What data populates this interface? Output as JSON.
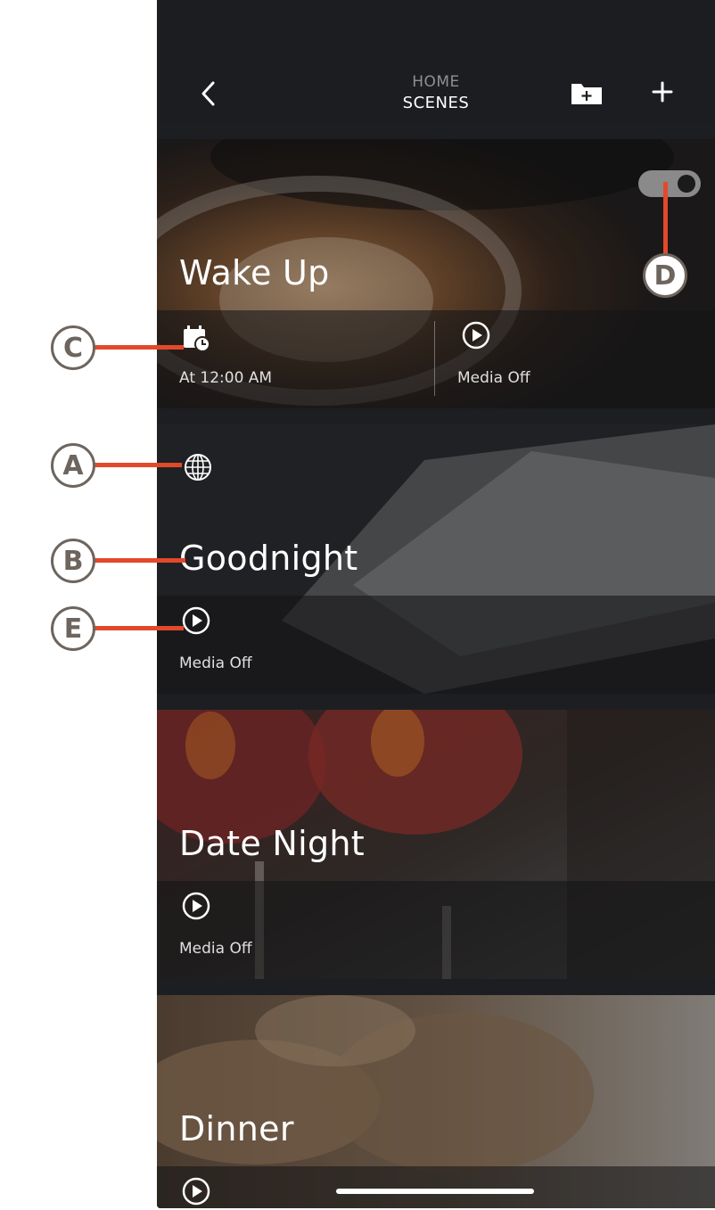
{
  "header": {
    "back_icon": "chevron-left-icon",
    "title_top": "HOME",
    "title_main": "SCENES",
    "folder_icon": "folder-add-icon",
    "add_icon": "plus-icon"
  },
  "scenes": [
    {
      "title": "Wake Up",
      "toggle_on": false,
      "actions": [
        {
          "icon": "calendar-clock-icon",
          "label": "At 12:00 AM"
        },
        {
          "icon": "play-circle-icon",
          "label": "Media Off"
        }
      ]
    },
    {
      "title": "Goodnight",
      "badge_icon": "globe-icon",
      "actions": [
        {
          "icon": "play-circle-icon",
          "label": "Media Off"
        }
      ]
    },
    {
      "title": "Date Night",
      "actions": [
        {
          "icon": "play-circle-icon",
          "label": "Media Off"
        }
      ]
    },
    {
      "title": "Dinner",
      "actions": [
        {
          "icon": "play-circle-icon",
          "label": ""
        }
      ]
    }
  ],
  "callouts": {
    "a": "A",
    "b": "B",
    "c": "C",
    "d": "D",
    "e": "E"
  },
  "colors": {
    "callout_line": "#e2492b",
    "callout_border": "#6d655e",
    "nav_bg": "#1c1d20"
  }
}
